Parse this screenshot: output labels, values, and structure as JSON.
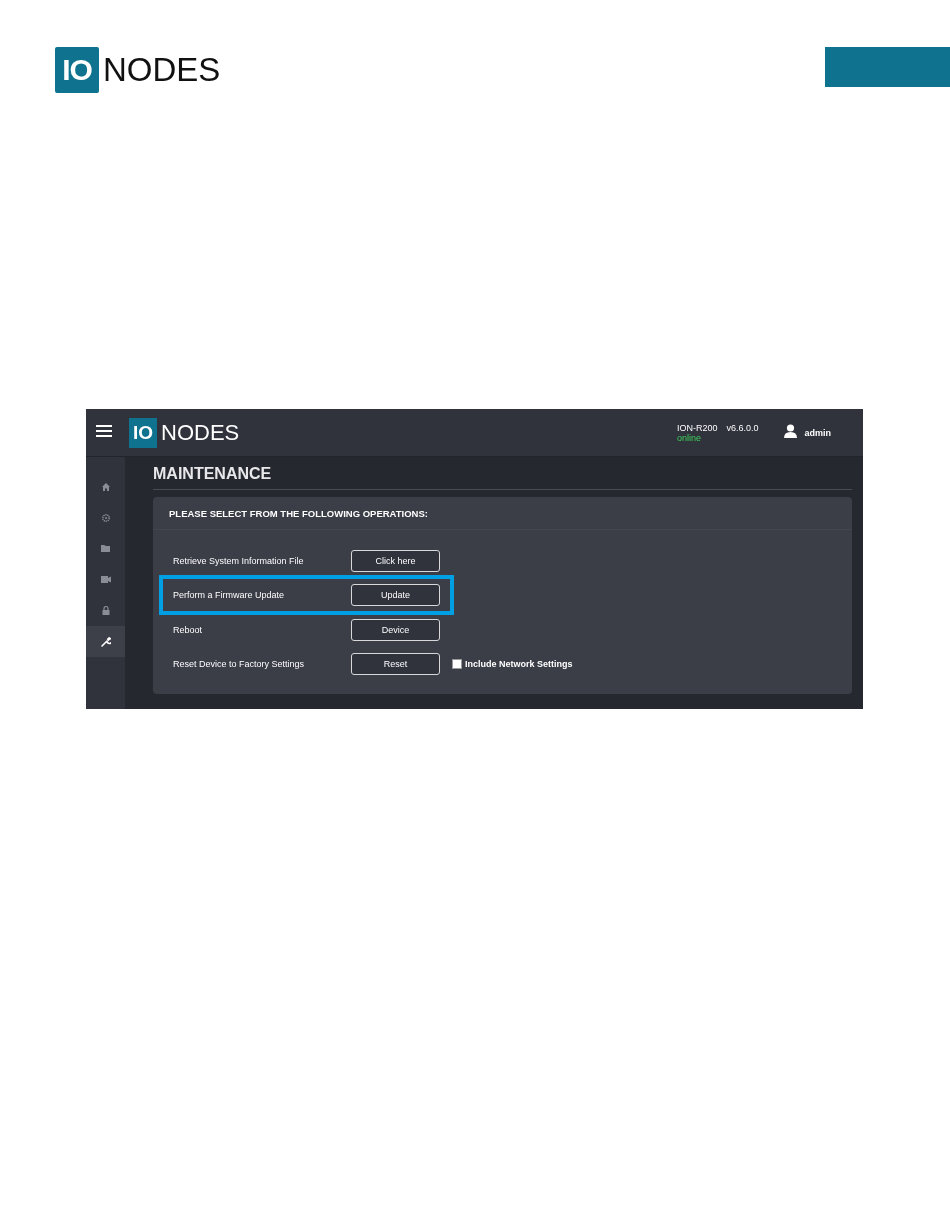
{
  "page_header": {
    "logo_mark": "IO",
    "logo_text": "NODES"
  },
  "app": {
    "header": {
      "logo_mark": "IO",
      "logo_text": "NODES",
      "device": "ION-R200",
      "version": "v6.6.0.0",
      "status": "online",
      "user": "admin"
    },
    "sidebar": {
      "items": [
        {
          "kind": "home",
          "selected": false
        },
        {
          "kind": "gear",
          "selected": false
        },
        {
          "kind": "folder",
          "selected": false
        },
        {
          "kind": "camera",
          "selected": false
        },
        {
          "kind": "lock",
          "selected": false
        },
        {
          "kind": "wrench",
          "selected": true
        }
      ]
    },
    "page_title": "MAINTENANCE",
    "panel": {
      "heading": "PLEASE SELECT FROM THE FOLLOWING OPERATIONS:",
      "rows": [
        {
          "label": "Retrieve System Information File",
          "button": "Click here",
          "highlighted": false
        },
        {
          "label": "Perform a Firmware Update",
          "button": "Update",
          "highlighted": true
        },
        {
          "label": "Reboot",
          "button": "Device",
          "highlighted": false
        },
        {
          "label": "Reset Device to Factory Settings",
          "button": "Reset",
          "highlighted": false,
          "option": {
            "label": "Include Network Settings",
            "checked": false
          }
        }
      ]
    }
  }
}
